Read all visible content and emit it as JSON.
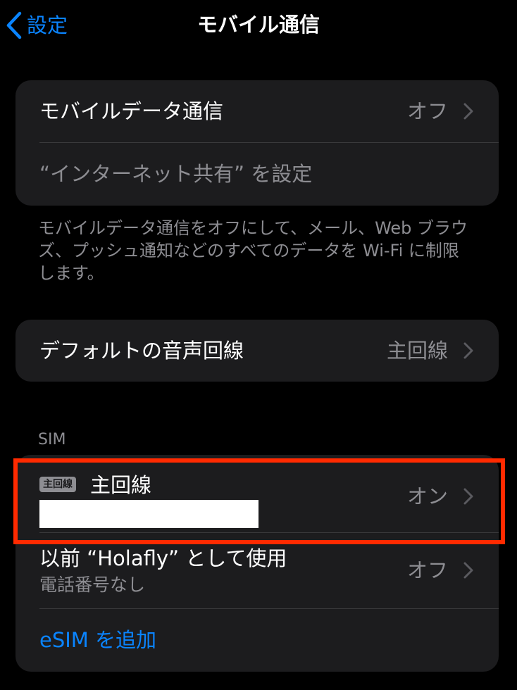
{
  "nav": {
    "back_label": "設定",
    "title": "モバイル通信"
  },
  "data_group": {
    "cellular_data_label": "モバイルデータ通信",
    "cellular_data_value": "オフ",
    "hotspot_label": "“インターネット共有” を設定"
  },
  "data_footer": "モバイルデータ通信をオフにして、メール、Web ブラウズ、プッシュ通知などのすべてのデータを Wi-Fi に制限します。",
  "voice_group": {
    "default_voice_label": "デフォルトの音声回線",
    "default_voice_value": "主回線"
  },
  "sim_section": {
    "header": "SIM",
    "primary": {
      "badge": "主回線",
      "label": "主回線",
      "value": "オン"
    },
    "holafly": {
      "label": "以前 “Holafly” として使用",
      "sublabel": "電話番号なし",
      "value": "オフ"
    },
    "add_esim_label": "eSIM を追加"
  },
  "colors": {
    "background": "#000000",
    "cell": "#1c1c1e",
    "accent_blue": "#0a84ff",
    "secondary_text": "#8d8d92",
    "highlight_red": "#ff2a00"
  },
  "icons": {
    "back": "chevron-left-icon",
    "disclosure": "chevron-right-icon"
  }
}
